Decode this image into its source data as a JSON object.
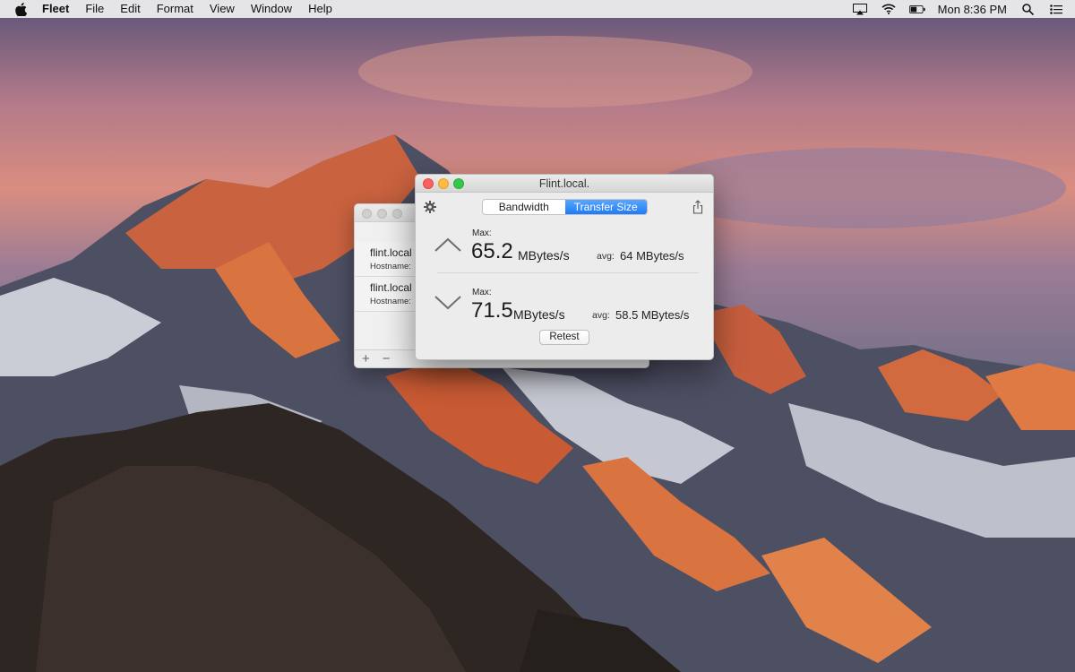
{
  "menubar": {
    "app_name": "Fleet",
    "items": [
      "File",
      "Edit",
      "Format",
      "View",
      "Window",
      "Help"
    ],
    "clock": "Mon 8:36 PM"
  },
  "icons": {
    "apple": "apple-icon",
    "airplay": "airplay-icon",
    "wifi": "wifi-icon",
    "battery": "battery-icon",
    "spotlight": "search-icon",
    "notification_center": "list-icon",
    "settings": "gear-icon",
    "share": "share-icon",
    "upload": "chevron-up-icon",
    "download": "chevron-down-icon"
  },
  "server_list": {
    "rows": [
      {
        "title": "flint.local l",
        "subtitle": "Hostname:"
      },
      {
        "title": "flint.local l",
        "subtitle": "Hostname:"
      }
    ],
    "add_label": "+",
    "remove_label": "−"
  },
  "window": {
    "title": "Flint.local.",
    "tabs": [
      "Bandwidth",
      "Transfer Size"
    ],
    "active_tab": "Transfer Size",
    "upload": {
      "max_label": "Max:",
      "value": "65.2",
      "unit": "MBytes/s",
      "avg_label": "avg:",
      "avg_value": "64 MBytes/s"
    },
    "download": {
      "max_label": "Max:",
      "value": "71.5",
      "unit": "MBytes/s",
      "avg_label": "avg:",
      "avg_value": "58.5 MBytes/s"
    },
    "retest_label": "Retest"
  },
  "colors": {
    "accent": "#1f7bf5",
    "close": "#fc615d",
    "minimize": "#fdbc40",
    "zoom": "#34c84a"
  }
}
